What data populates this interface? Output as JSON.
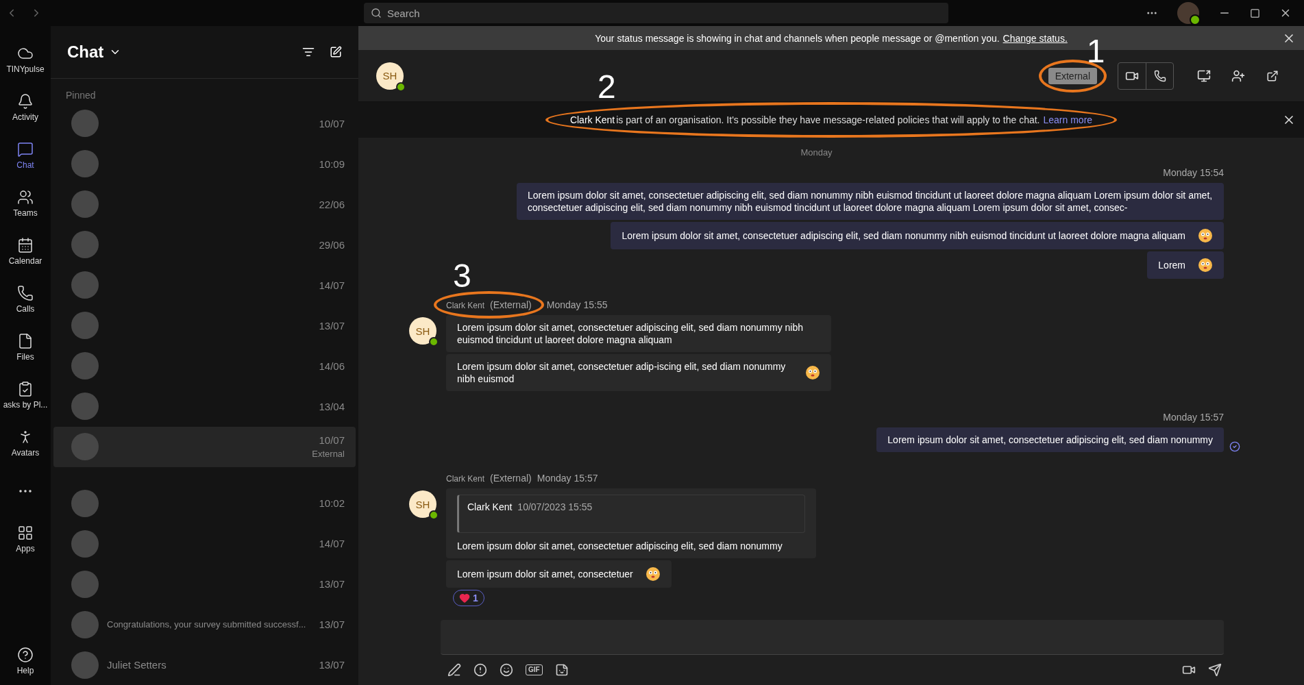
{
  "search": {
    "placeholder": "Search"
  },
  "rail": [
    {
      "kind": "logo",
      "label": "TINYpulse",
      "selected": false
    },
    {
      "kind": "bell",
      "label": "Activity",
      "selected": false
    },
    {
      "kind": "chat",
      "label": "Chat",
      "selected": true
    },
    {
      "kind": "teams",
      "label": "Teams",
      "selected": false
    },
    {
      "kind": "calendar",
      "label": "Calendar",
      "selected": false
    },
    {
      "kind": "phone",
      "label": "Calls",
      "selected": false
    },
    {
      "kind": "file",
      "label": "Files",
      "selected": false
    },
    {
      "kind": "tasks",
      "label": "asks by Pl...",
      "selected": false
    },
    {
      "kind": "avatar",
      "label": "Avatars",
      "selected": false
    },
    {
      "kind": "more",
      "selected": false
    },
    {
      "kind": "apps",
      "label": "Apps",
      "selected": false
    }
  ],
  "help": {
    "label": "Help"
  },
  "chat_list": {
    "title": "Chat",
    "pinned_label": "Pinned",
    "sections": [
      {
        "rows": [
          {
            "date": "10/07",
            "selected": false
          },
          {
            "date": "10:09",
            "selected": false
          },
          {
            "date": "22/06",
            "selected": false
          },
          {
            "date": "29/06",
            "selected": false
          },
          {
            "date": "14/07",
            "selected": false
          },
          {
            "date": "13/07",
            "selected": false
          },
          {
            "date": "14/06",
            "selected": false
          },
          {
            "date": "13/04",
            "selected": false
          },
          {
            "date": "10/07",
            "tag": "External",
            "selected": true
          }
        ]
      },
      {
        "rows": [
          {
            "date": "10:02",
            "selected": false
          },
          {
            "date": "14/07",
            "selected": false
          },
          {
            "date": "13/07",
            "selected": false
          },
          {
            "date": "13/07",
            "preview": "Congratulations, your survey submitted successf...",
            "selected": false
          },
          {
            "date": "13/07",
            "name": "Juliet Setters",
            "selected": false
          }
        ]
      }
    ]
  },
  "status_banner": {
    "text": "Your status message is showing in chat and channels when people message or @mention you.",
    "link": "Change status."
  },
  "header": {
    "avatar": "SH",
    "badge": "External"
  },
  "info_banner": {
    "name": "Clark Kent",
    "text": "is part of an organisation. It's possible they have message-related policies that will apply to the chat.",
    "link": "Learn more"
  },
  "day_divider": "Monday",
  "groups": [
    {
      "kind": "out",
      "time": "Monday 15:54",
      "messages": [
        {
          "text": "Lorem ipsum dolor sit amet, consectetuer adipiscing elit, sed diam nonummy nibh euismod tincidunt ut laoreet dolore magna aliquam Lorem ipsum dolor sit amet, consectetuer adipiscing elit, sed diam nonummy nibh euismod tincidunt ut laoreet dolore magna aliquam Lorem ipsum dolor sit amet, consec-",
          "emoji": false
        },
        {
          "text": "Lorem ipsum dolor sit amet, consectetuer adipiscing elit, sed diam nonummy nibh euismod tincidunt ut laoreet dolore magna aliquam",
          "emoji": true
        },
        {
          "text": "Lorem",
          "emoji": true
        }
      ]
    },
    {
      "kind": "in",
      "avatar": "SH",
      "sender": "Clark Kent",
      "tag": "(External)",
      "time": "Monday 15:55",
      "messages": [
        {
          "text": "Lorem ipsum dolor sit amet, consectetuer adipiscing elit, sed diam nonummy nibh euismod tincidunt ut laoreet dolore magna aliquam",
          "emoji": false
        },
        {
          "text": "Lorem ipsum dolor sit amet, consectetuer adip-iscing elit, sed diam nonummy nibh euismod",
          "emoji": true
        }
      ]
    },
    {
      "kind": "out",
      "time": "Monday 15:57",
      "read": true,
      "messages": [
        {
          "text": "Lorem ipsum dolor sit amet, consectetuer adipiscing elit, sed diam nonummy",
          "emoji": false
        }
      ]
    },
    {
      "kind": "in",
      "avatar": "SH",
      "sender": "Clark Kent",
      "tag": "(External)",
      "time": "Monday 15:57",
      "messages": [
        {
          "quote": {
            "author": "Clark Kent",
            "time": "10/07/2023 15:55"
          },
          "text": "Lorem ipsum dolor sit amet, consectetuer adipiscing elit, sed diam nonummy",
          "emoji": false
        },
        {
          "text": "Lorem ipsum dolor sit amet, consectetuer",
          "emoji": true,
          "reaction": "1"
        }
      ]
    }
  ],
  "composer": {
    "gif_label": "GIF"
  },
  "annotations": [
    {
      "label": "1"
    },
    {
      "label": "2"
    },
    {
      "label": "3"
    }
  ]
}
